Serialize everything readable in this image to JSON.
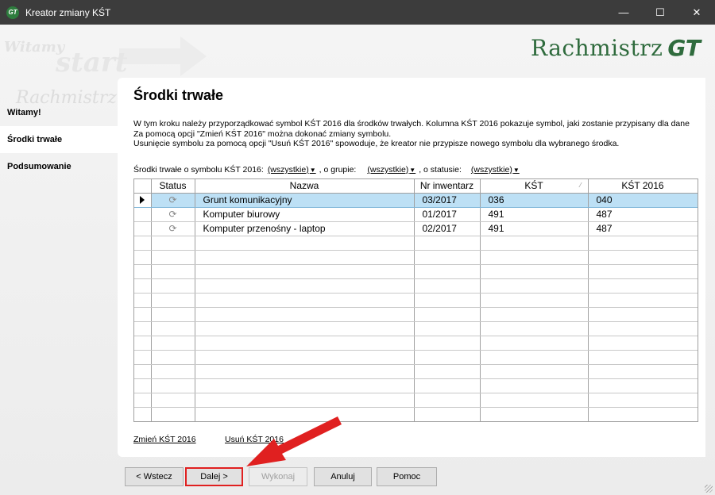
{
  "window": {
    "title": "Kreator zmiany KŚT",
    "minimize": "—",
    "maximize": "☐",
    "close": "✕"
  },
  "logo": {
    "text": "Rachmistrz",
    "suffix": "GT"
  },
  "watermark": {
    "w1": "Witamy",
    "w2": "start",
    "w3": "Rachmistrz"
  },
  "sidebar": {
    "items": [
      {
        "label": "Witamy!"
      },
      {
        "label": "Środki trwałe"
      },
      {
        "label": "Podsumowanie"
      }
    ]
  },
  "main": {
    "title": "Środki trwałe",
    "description": [
      "W tym kroku należy przyporządkować symbol KŚT 2016 dla środków trwałych. Kolumna KŚT 2016 pokazuje symbol, jaki zostanie przypisany dla dane",
      "Za pomocą opcji \"Zmień KŚT 2016\" można dokonać zmiany symbolu.",
      "Usunięcie symbolu za pomocą opcji \"Usuń KŚT 2016\" spowoduje, że kreator nie przypisze nowego symbolu dla wybranego środka."
    ],
    "filters": {
      "label1": "Środki trwałe o symbolu KŚT 2016:",
      "value1": "(wszystkie)",
      "label2": ", o grupie:",
      "value2": "(wszystkie)",
      "label3": ", o statusie:",
      "value3": "(wszystkie)"
    },
    "table": {
      "columns": [
        "Status",
        "Nazwa",
        "Nr inwentarz",
        "KŚT",
        "KŚT 2016"
      ],
      "rows": [
        {
          "status": "⟳",
          "name": "Grunt komunikacyjny",
          "nr": "03/2017",
          "kst": "036",
          "kst2016": "040"
        },
        {
          "status": "⟳",
          "name": "Komputer biurowy",
          "nr": "01/2017",
          "kst": "491",
          "kst2016": "487"
        },
        {
          "status": "⟳",
          "name": "Komputer przenośny - laptop",
          "nr": "02/2017",
          "kst": "491",
          "kst2016": "487"
        }
      ]
    },
    "links": {
      "change": "Zmień KŚT 2016",
      "remove": "Usuń KŚT 2016"
    }
  },
  "buttons": {
    "back": "< Wstecz",
    "next": "Dalej >",
    "execute": "Wykonaj",
    "cancel": "Anuluj",
    "help": "Pomoc"
  },
  "colors": {
    "accent": "#2f6b3d",
    "selection": "#bde0f5",
    "annotation": "#e02020"
  }
}
